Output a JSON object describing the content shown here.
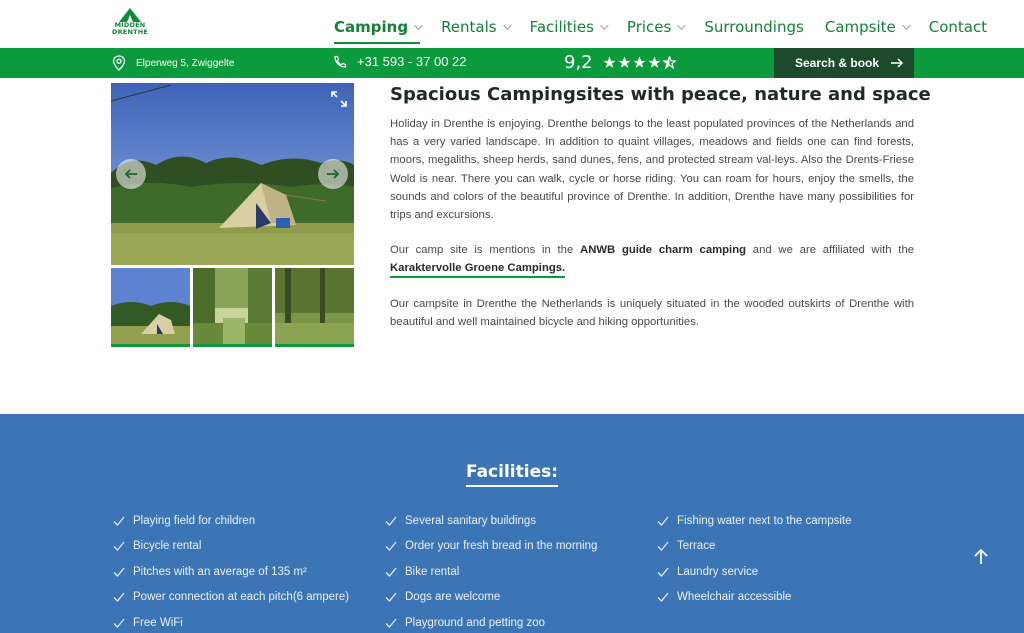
{
  "logo": {
    "line1": "MIDDEN",
    "line2": "DRENTHE"
  },
  "nav": [
    {
      "label": "Camping",
      "dropdown": true,
      "active": true
    },
    {
      "label": "Rentals",
      "dropdown": true
    },
    {
      "label": "Facilities",
      "dropdown": true
    },
    {
      "label": "Prices",
      "dropdown": true
    },
    {
      "label": "Surroundings",
      "dropdown": false
    },
    {
      "label": "Campsite",
      "dropdown": true
    },
    {
      "label": "Contact",
      "dropdown": false
    }
  ],
  "topbar": {
    "address": "Elperweg 5, Zwiggelte",
    "phone": "+31 593 - 37 00 22",
    "score": "9,2",
    "stars": 4.5,
    "book_label": "Search & book"
  },
  "content": {
    "title": "Spacious Campingsites with peace, nature and space",
    "p1": "Holiday in Drenthe is enjoying. Drenthe belongs to the least populated provinces of the Netherlands and has a very varied landscape. In addition to quaint villages, meadows and fields one can find forests, moors, megaliths, sheep herds, sand dunes, fens, and protected stream val-leys. Also the Drents-Friese Wold is near. There you can walk, cycle or horse riding. You can roam for hours, enjoy the smells, the sounds and colors of the beautiful province of Drenthe. In addition, Drenthe have many possibilities for trips and excursions.",
    "p2_before": "Our camp site is mentions in the ",
    "p2_bold": "ANWB guide charm camping",
    "p2_middle": " and we are affiliated with the ",
    "p2_link": "Karaktervolle Groene Campings.",
    "p3": "Our campsite in Drenthe the Netherlands is uniquely situated in the wooded outskirts of Drenthe with beautiful and well maintained bicycle and hiking opportunities."
  },
  "facilities": {
    "title": "Facilities:",
    "col1": [
      "Playing field for children",
      "Bicycle rental",
      "Pitches with  an average of 135 m²",
      "Power connection at each pitch(6 ampere)",
      "Free WiFi"
    ],
    "col2": [
      "Several sanitary buildings",
      "Order your fresh bread in the morning",
      "Bike rental",
      "Dogs are welcome",
      "Playground and petting zoo"
    ],
    "col3": [
      "Fishing water next to the campsite",
      "Terrace",
      "Laundry service",
      "Wheelchair accessible"
    ]
  },
  "colors": {
    "brand_green": "#0b9a3c",
    "dark_green": "#1d4a2c",
    "facilities_blue": "#3c75b5"
  }
}
